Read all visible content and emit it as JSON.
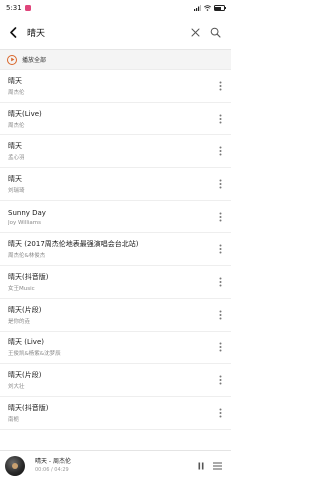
{
  "status_bar": {
    "time": "5:31"
  },
  "search": {
    "query": "晴天",
    "placeholder": ""
  },
  "play_all": {
    "label": "播放全部"
  },
  "songs": [
    {
      "title": "晴天",
      "artist": "周杰伦"
    },
    {
      "title": "晴天(Live)",
      "artist": "周杰伦"
    },
    {
      "title": "晴天",
      "artist": "孟心羽"
    },
    {
      "title": "晴天",
      "artist": "刘瑞琦"
    },
    {
      "title": "Sunny Day",
      "artist": "Joy Williams"
    },
    {
      "title": "晴天 (2017周杰伦地表最强演唱会台北站)",
      "artist": "周杰伦&林俊杰"
    },
    {
      "title": "晴天(抖音版)",
      "artist": "女王Music"
    },
    {
      "title": "晴天(片段)",
      "artist": "是你的垚"
    },
    {
      "title": "晴天 (Live)",
      "artist": "王俊凯&杨紫&沈梦辰"
    },
    {
      "title": "晴天(片段)",
      "artist": "刘大壮"
    },
    {
      "title": "晴天(抖音版)",
      "artist": "南栀"
    }
  ],
  "now_playing": {
    "title": "晴天 - 周杰伦",
    "time": "00:06 / 04:29"
  },
  "colors": {
    "accent": "#d9662a",
    "notification": "#e0457b"
  }
}
